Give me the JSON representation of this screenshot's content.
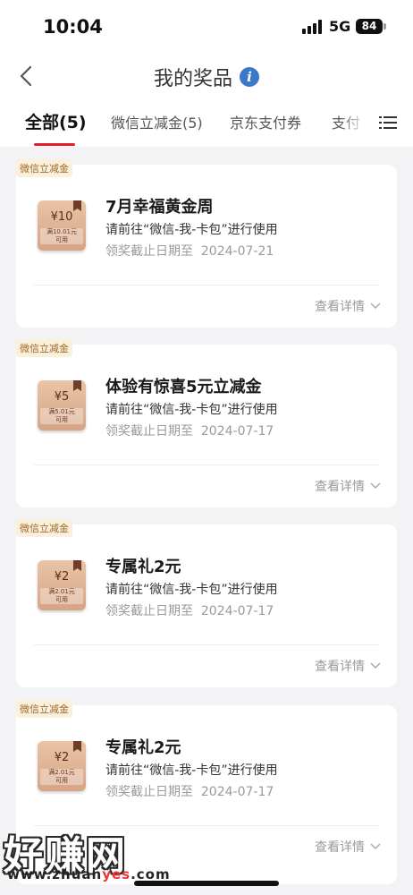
{
  "status_bar": {
    "time": "10:04",
    "network": "5G",
    "battery": "84"
  },
  "nav": {
    "title": "我的奖品",
    "info_icon": "info-icon",
    "back_icon": "chevron-left-icon"
  },
  "tabs": {
    "items": [
      {
        "label": "全部(5)",
        "active": true
      },
      {
        "label": "微信立减金(5)"
      },
      {
        "label": "京东支付券"
      },
      {
        "label": "支付"
      }
    ],
    "menu_icon": "list-menu-icon"
  },
  "prizes": [
    {
      "tag": "微信立减金",
      "coupon_amount": "¥10",
      "coupon_condition": "满10.01元\n可用",
      "title": "7月幸福黄金周",
      "desc": "请前往“微信-我-卡包”进行使用",
      "deadline": "领奖截止日期至  2024-07-21",
      "details_label": "查看详情"
    },
    {
      "tag": "微信立减金",
      "coupon_amount": "¥5",
      "coupon_condition": "满5.01元\n可用",
      "title": "体验有惊喜5元立减金",
      "desc": "请前往“微信-我-卡包”进行使用",
      "deadline": "领奖截止日期至  2024-07-17",
      "details_label": "查看详情"
    },
    {
      "tag": "微信立减金",
      "coupon_amount": "¥2",
      "coupon_condition": "满2.01元\n可用",
      "title": "专属礼2元",
      "desc": "请前往“微信-我-卡包”进行使用",
      "deadline": "领奖截止日期至  2024-07-17",
      "details_label": "查看详情"
    },
    {
      "tag": "微信立减金",
      "coupon_amount": "¥2",
      "coupon_condition": "满2.01元\n可用",
      "title": "专属礼2元",
      "desc": "请前往“微信-我-卡包”进行使用",
      "deadline": "领奖截止日期至  2024-07-17",
      "details_label": "查看详情"
    }
  ],
  "watermark": {
    "text": "好赚网",
    "url_prefix": "www.zhuan",
    "url_highlight": "yes",
    "url_suffix": ".com"
  }
}
